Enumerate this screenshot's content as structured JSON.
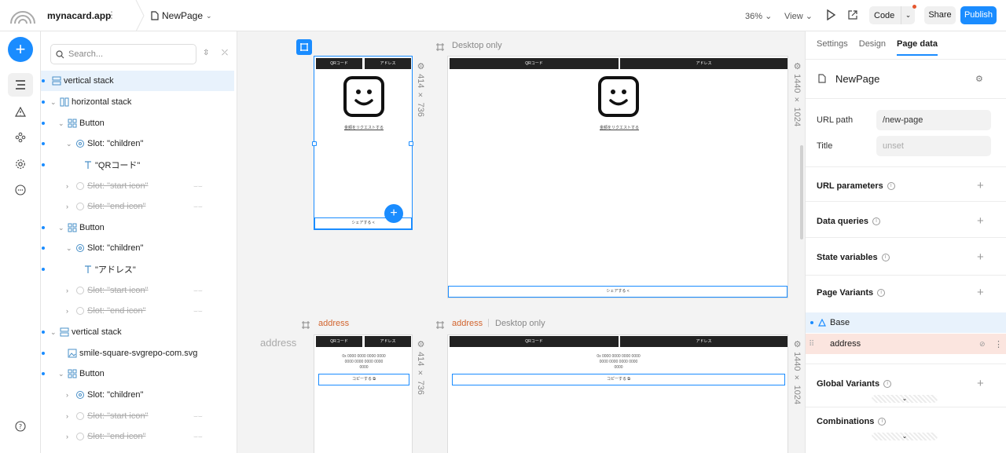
{
  "app": {
    "name": "mynacard.app",
    "page_name": "NewPage"
  },
  "toolbar": {
    "zoom": "36%",
    "view_label": "View",
    "code_label": "Code",
    "share_label": "Share",
    "publish_label": "Publish"
  },
  "colors": {
    "accent": "#1a8cff",
    "variant_orange": "#d2642e",
    "variant_bg": "#fbe5df"
  },
  "tree": {
    "search_placeholder": "Search...",
    "items": [
      {
        "label": "vertical stack",
        "icon": "vertical-stack-icon"
      },
      {
        "label": "horizontal stack",
        "icon": "horizontal-stack-icon"
      },
      {
        "label": "Button",
        "icon": "component-icon"
      },
      {
        "label": "Slot: \"children\"",
        "icon": "slot-icon"
      },
      {
        "label": "\"QRコード\"",
        "icon": "text-icon"
      },
      {
        "label": "Slot: \"start icon\"",
        "icon": "slot-icon"
      },
      {
        "label": "Slot: \"end icon\"",
        "icon": "slot-icon"
      },
      {
        "label": "Button",
        "icon": "component-icon"
      },
      {
        "label": "Slot: \"children\"",
        "icon": "slot-icon"
      },
      {
        "label": "\"アドレス\"",
        "icon": "text-icon"
      },
      {
        "label": "Slot: \"start icon\"",
        "icon": "slot-icon"
      },
      {
        "label": "Slot: \"end icon\"",
        "icon": "slot-icon"
      },
      {
        "label": "vertical stack",
        "icon": "vertical-stack-icon"
      },
      {
        "label": "smile-square-svgrepo-com.svg",
        "icon": "image-icon"
      },
      {
        "label": "Button",
        "icon": "component-icon"
      },
      {
        "label": "Slot: \"children\"",
        "icon": "slot-icon"
      },
      {
        "label": "Slot: \"start icon\"",
        "icon": "slot-icon"
      },
      {
        "label": "Slot: \"end icon\"",
        "icon": "slot-icon"
      }
    ]
  },
  "canvas": {
    "frame_base_size": "414 × 736",
    "frame_desktop_size": "1440 × 1024",
    "desktop_only_label": "Desktop only",
    "address_label": "address",
    "address_row_label": "address",
    "button_qr": "QRコード",
    "button_address": "アドレス",
    "request_link": "金額をリクエストする",
    "share_button": "シェアする <",
    "copy_button": "コピーする ⧉",
    "address_text": "0x 0000 0000 0000 0000 0000 0000 0000 0000 0000"
  },
  "right_panel": {
    "tabs": [
      "Settings",
      "Design",
      "Page data"
    ],
    "page_name": "NewPage",
    "url_path_label": "URL path",
    "url_path_value": "/new-page",
    "title_label": "Title",
    "title_placeholder": "unset",
    "sections": {
      "url_parameters": "URL parameters",
      "data_queries": "Data queries",
      "state_variables": "State variables",
      "page_variants": "Page Variants",
      "global_variants": "Global Variants",
      "combinations": "Combinations"
    },
    "variants": {
      "base": "Base",
      "address": "address"
    }
  }
}
